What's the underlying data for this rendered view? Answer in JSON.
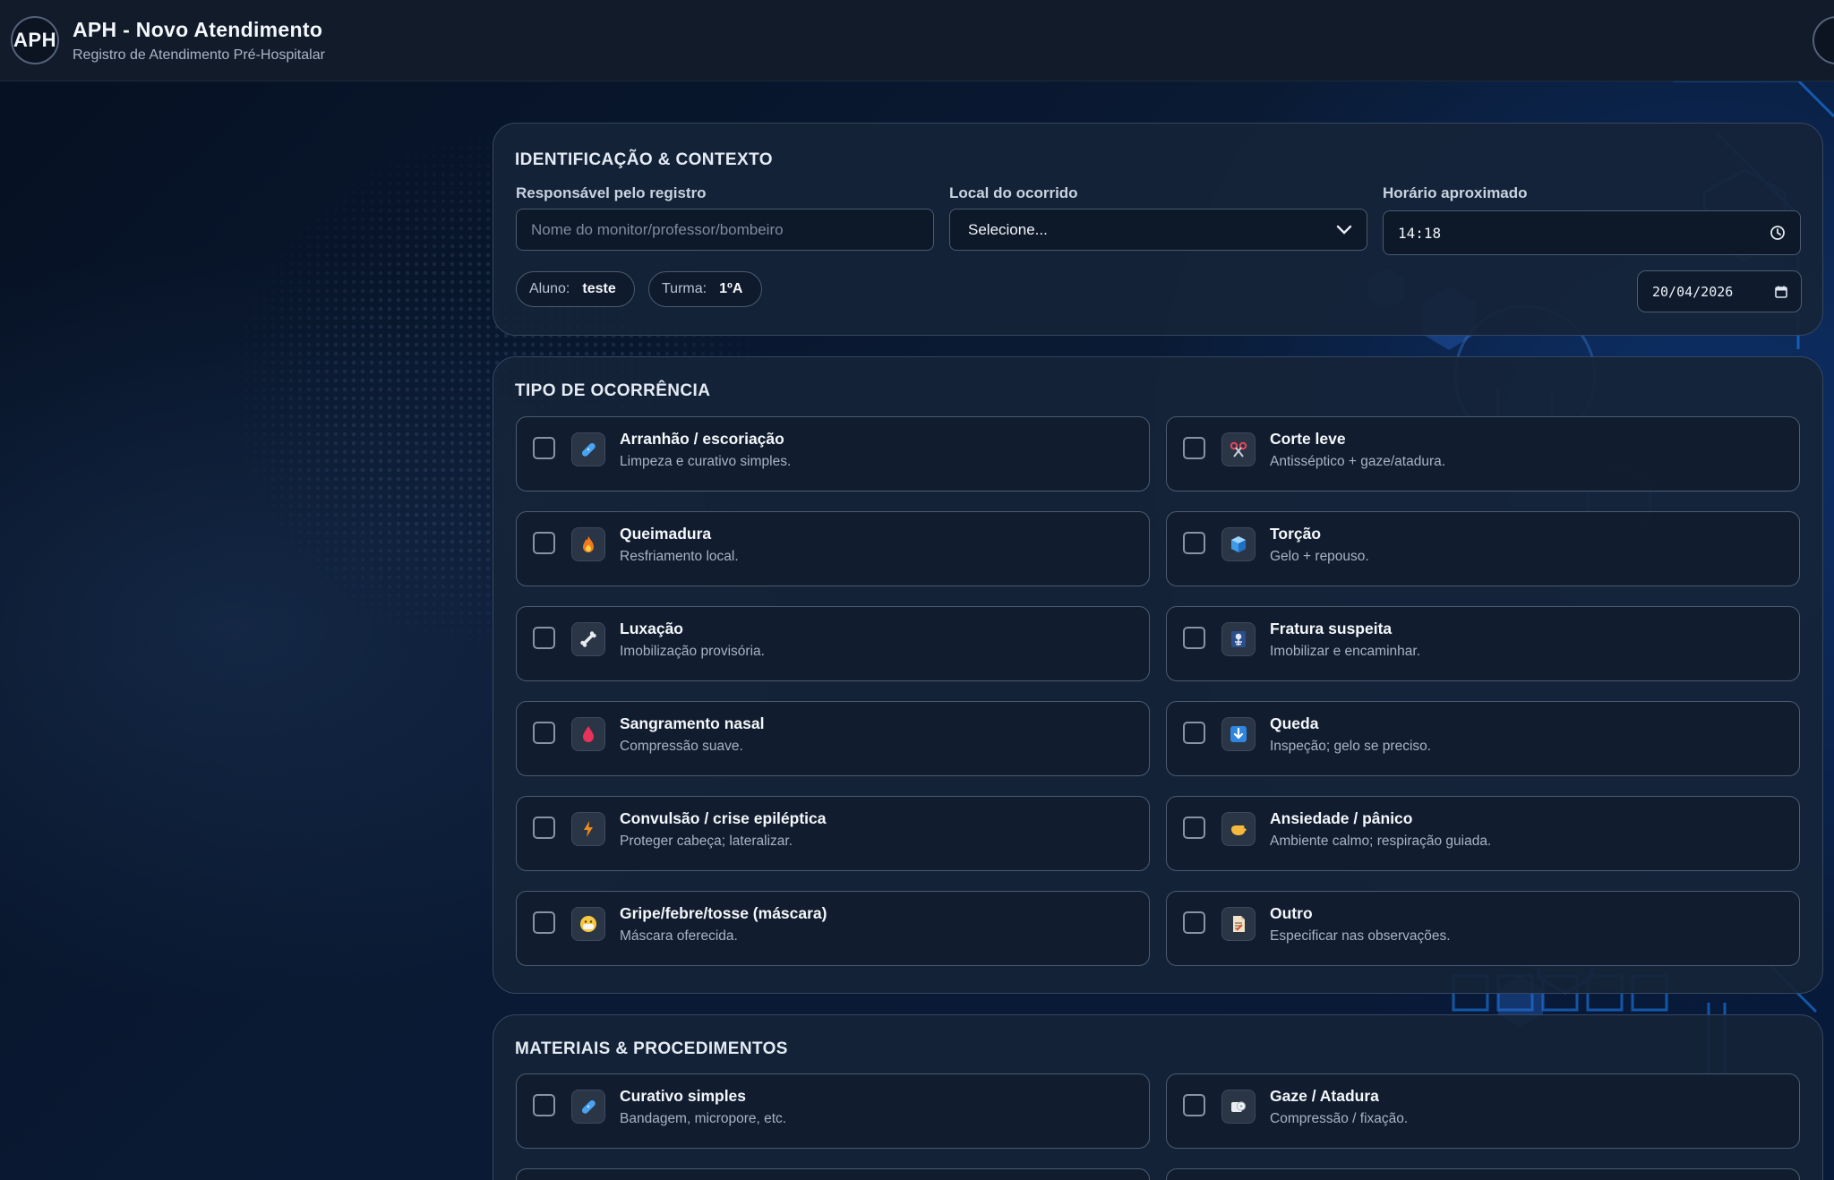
{
  "header": {
    "logo_text": "APH",
    "title": "APH - Novo Atendimento",
    "subtitle": "Registro de Atendimento Pré-Hospitalar"
  },
  "identificacao": {
    "title": "IDENTIFICAÇÃO & CONTEXTO",
    "responsavel_label": "Responsável pelo registro",
    "responsavel_placeholder": "Nome do monitor/professor/bombeiro",
    "responsavel_value": "",
    "local_label": "Local do ocorrido",
    "local_value": "Selecione...",
    "horario_label": "Horário aproximado",
    "horario_value": "14:18",
    "aluno_label": "Aluno:",
    "aluno_value": "teste",
    "turma_label": "Turma:",
    "turma_value": "1ºA",
    "data_value": "20/04/2026"
  },
  "ocorrencia": {
    "title": "TIPO DE OCORRÊNCIA",
    "items": [
      {
        "title": "Arranhão / escoriação",
        "desc": "Limpeza e curativo simples.",
        "icon": "bandage-icon",
        "checked": false
      },
      {
        "title": "Corte leve",
        "desc": "Antisséptico + gaze/atadura.",
        "icon": "scissors-icon",
        "checked": false
      },
      {
        "title": "Queimadura",
        "desc": "Resfriamento local.",
        "icon": "fire-icon",
        "checked": false
      },
      {
        "title": "Torção",
        "desc": "Gelo + repouso.",
        "icon": "ice-cube-icon",
        "checked": false
      },
      {
        "title": "Luxação",
        "desc": "Imobilização provisória.",
        "icon": "bone-icon",
        "checked": false
      },
      {
        "title": "Fratura suspeita",
        "desc": "Imobilizar e encaminhar.",
        "icon": "x-ray-icon",
        "checked": false
      },
      {
        "title": "Sangramento nasal",
        "desc": "Compressão suave.",
        "icon": "blood-drop-icon",
        "checked": false
      },
      {
        "title": "Queda",
        "desc": "Inspeção; gelo se preciso.",
        "icon": "down-arrow-icon",
        "checked": false
      },
      {
        "title": "Convulsão / crise epiléptica",
        "desc": "Proteger cabeça; lateralizar.",
        "icon": "lightning-icon",
        "checked": false
      },
      {
        "title": "Ansiedade / pânico",
        "desc": "Ambiente calmo; respiração guiada.",
        "icon": "hand-icon",
        "checked": false
      },
      {
        "title": "Gripe/febre/tosse (máscara)",
        "desc": "Máscara oferecida.",
        "icon": "mask-face-icon",
        "checked": false
      },
      {
        "title": "Outro",
        "desc": "Especificar nas observações.",
        "icon": "note-icon",
        "checked": false
      }
    ]
  },
  "materiais": {
    "title": "MATERIAIS & PROCEDIMENTOS",
    "items": [
      {
        "title": "Curativo simples",
        "desc": "Bandagem, micropore, etc.",
        "icon": "bandage-icon",
        "checked": false
      },
      {
        "title": "Gaze / Atadura",
        "desc": "Compressão / fixação.",
        "icon": "gauze-roll-icon",
        "checked": false
      }
    ]
  },
  "colors": {
    "background": "#071426",
    "panel": "#162438",
    "border": "#4a5b72",
    "accent_blue": "#1e88ff"
  }
}
